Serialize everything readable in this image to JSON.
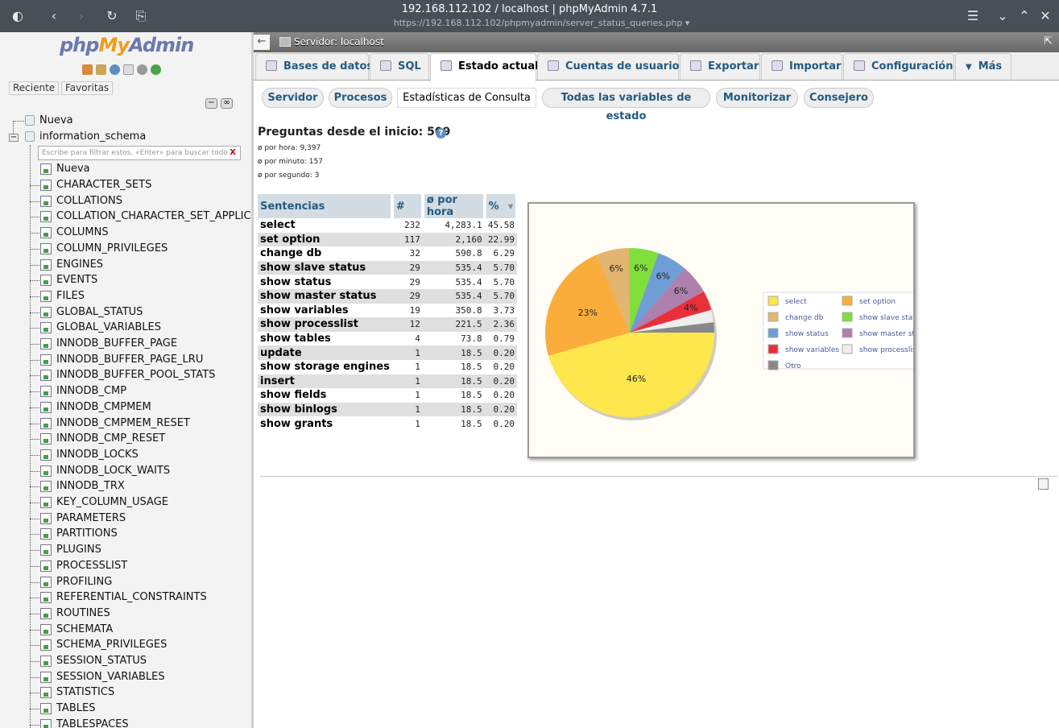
{
  "window": {
    "title": "192.168.112.102 / localhost | phpMyAdmin 4.7.1",
    "url": "https://192.168.112.102/phpmyadmin/server_status_queries.php ▾"
  },
  "sidebar": {
    "logo_php": "php",
    "logo_my": "My",
    "logo_admin": "Admin",
    "recent_label": "Reciente",
    "favorites_label": "Favoritas",
    "new_label": "Nueva",
    "db_name": "information_schema",
    "filter_placeholder": "Escribe para filtrar estos, «Enter» para buscar todo",
    "filter_clear": "X",
    "table_new_label": "Nueva",
    "tables": [
      "CHARACTER_SETS",
      "COLLATIONS",
      "COLLATION_CHARACTER_SET_APPLIC.",
      "COLUMNS",
      "COLUMN_PRIVILEGES",
      "ENGINES",
      "EVENTS",
      "FILES",
      "GLOBAL_STATUS",
      "GLOBAL_VARIABLES",
      "INNODB_BUFFER_PAGE",
      "INNODB_BUFFER_PAGE_LRU",
      "INNODB_BUFFER_POOL_STATS",
      "INNODB_CMP",
      "INNODB_CMPMEM",
      "INNODB_CMPMEM_RESET",
      "INNODB_CMP_RESET",
      "INNODB_LOCKS",
      "INNODB_LOCK_WAITS",
      "INNODB_TRX",
      "KEY_COLUMN_USAGE",
      "PARAMETERS",
      "PARTITIONS",
      "PLUGINS",
      "PROCESSLIST",
      "PROFILING",
      "REFERENTIAL_CONSTRAINTS",
      "ROUTINES",
      "SCHEMATA",
      "SCHEMA_PRIVILEGES",
      "SESSION_STATUS",
      "SESSION_VARIABLES",
      "STATISTICS",
      "TABLES",
      "TABLESPACES"
    ]
  },
  "breadcrumb": {
    "server": "Servidor: localhost"
  },
  "tabs": [
    {
      "label": "Bases de datos",
      "icon": "database-icon"
    },
    {
      "label": "SQL",
      "icon": "sql-icon"
    },
    {
      "label": "Estado actual",
      "icon": "status-icon"
    },
    {
      "label": "Cuentas de usuarios",
      "icon": "users-icon"
    },
    {
      "label": "Exportar",
      "icon": "export-icon"
    },
    {
      "label": "Importar",
      "icon": "import-icon"
    },
    {
      "label": "Configuración",
      "icon": "wrench-icon"
    },
    {
      "label": "Más",
      "icon": "chevron-down-icon"
    }
  ],
  "subtabs": [
    "Servidor",
    "Procesos",
    "Estadísticas de Consulta",
    "Todas las variables de estado",
    "Monitorizar",
    "Consejero"
  ],
  "queries": {
    "title": "Preguntas desde el inicio: 509",
    "per_hour": "ø por hora: 9,397",
    "per_minute": "ø por minuto: 157",
    "per_second": "ø por segundo: 3"
  },
  "table": {
    "headers": [
      "Sentencias",
      "#",
      "ø por hora",
      "%"
    ],
    "rows": [
      [
        "select",
        "232",
        "4,283.1",
        "45.58"
      ],
      [
        "set option",
        "117",
        "2,160",
        "22.99"
      ],
      [
        "change db",
        "32",
        "590.8",
        "6.29"
      ],
      [
        "show slave status",
        "29",
        "535.4",
        "5.70"
      ],
      [
        "show status",
        "29",
        "535.4",
        "5.70"
      ],
      [
        "show master status",
        "29",
        "535.4",
        "5.70"
      ],
      [
        "show variables",
        "19",
        "350.8",
        "3.73"
      ],
      [
        "show processlist",
        "12",
        "221.5",
        "2.36"
      ],
      [
        "show tables",
        "4",
        "73.8",
        "0.79"
      ],
      [
        "update",
        "1",
        "18.5",
        "0.20"
      ],
      [
        "show storage engines",
        "1",
        "18.5",
        "0.20"
      ],
      [
        "insert",
        "1",
        "18.5",
        "0.20"
      ],
      [
        "show fields",
        "1",
        "18.5",
        "0.20"
      ],
      [
        "show binlogs",
        "1",
        "18.5",
        "0.20"
      ],
      [
        "show grants",
        "1",
        "18.5",
        "0.20"
      ]
    ]
  },
  "chart_data": {
    "type": "pie",
    "slices": [
      {
        "label": "select",
        "value": 45.58,
        "text": "46%",
        "color": "#fde74c"
      },
      {
        "label": "set option",
        "value": 22.99,
        "text": "23%",
        "color": "#fbad3c"
      },
      {
        "label": "change db",
        "value": 6.29,
        "text": "6%",
        "color": "#e2b670"
      },
      {
        "label": "show slave status",
        "value": 5.7,
        "text": "6%",
        "color": "#81df3c"
      },
      {
        "label": "show status",
        "value": 5.7,
        "text": "6%",
        "color": "#6f9dd6"
      },
      {
        "label": "show master status",
        "value": 5.7,
        "text": "6%",
        "color": "#ad80ad"
      },
      {
        "label": "show variables",
        "value": 3.73,
        "text": "4%",
        "color": "#e9303a"
      },
      {
        "label": "show processlist",
        "value": 2.36,
        "text": "",
        "color": "#eeeeee"
      },
      {
        "label": "Otro",
        "value": 1.95,
        "text": "",
        "color": "#888888"
      }
    ],
    "legend": "right"
  }
}
